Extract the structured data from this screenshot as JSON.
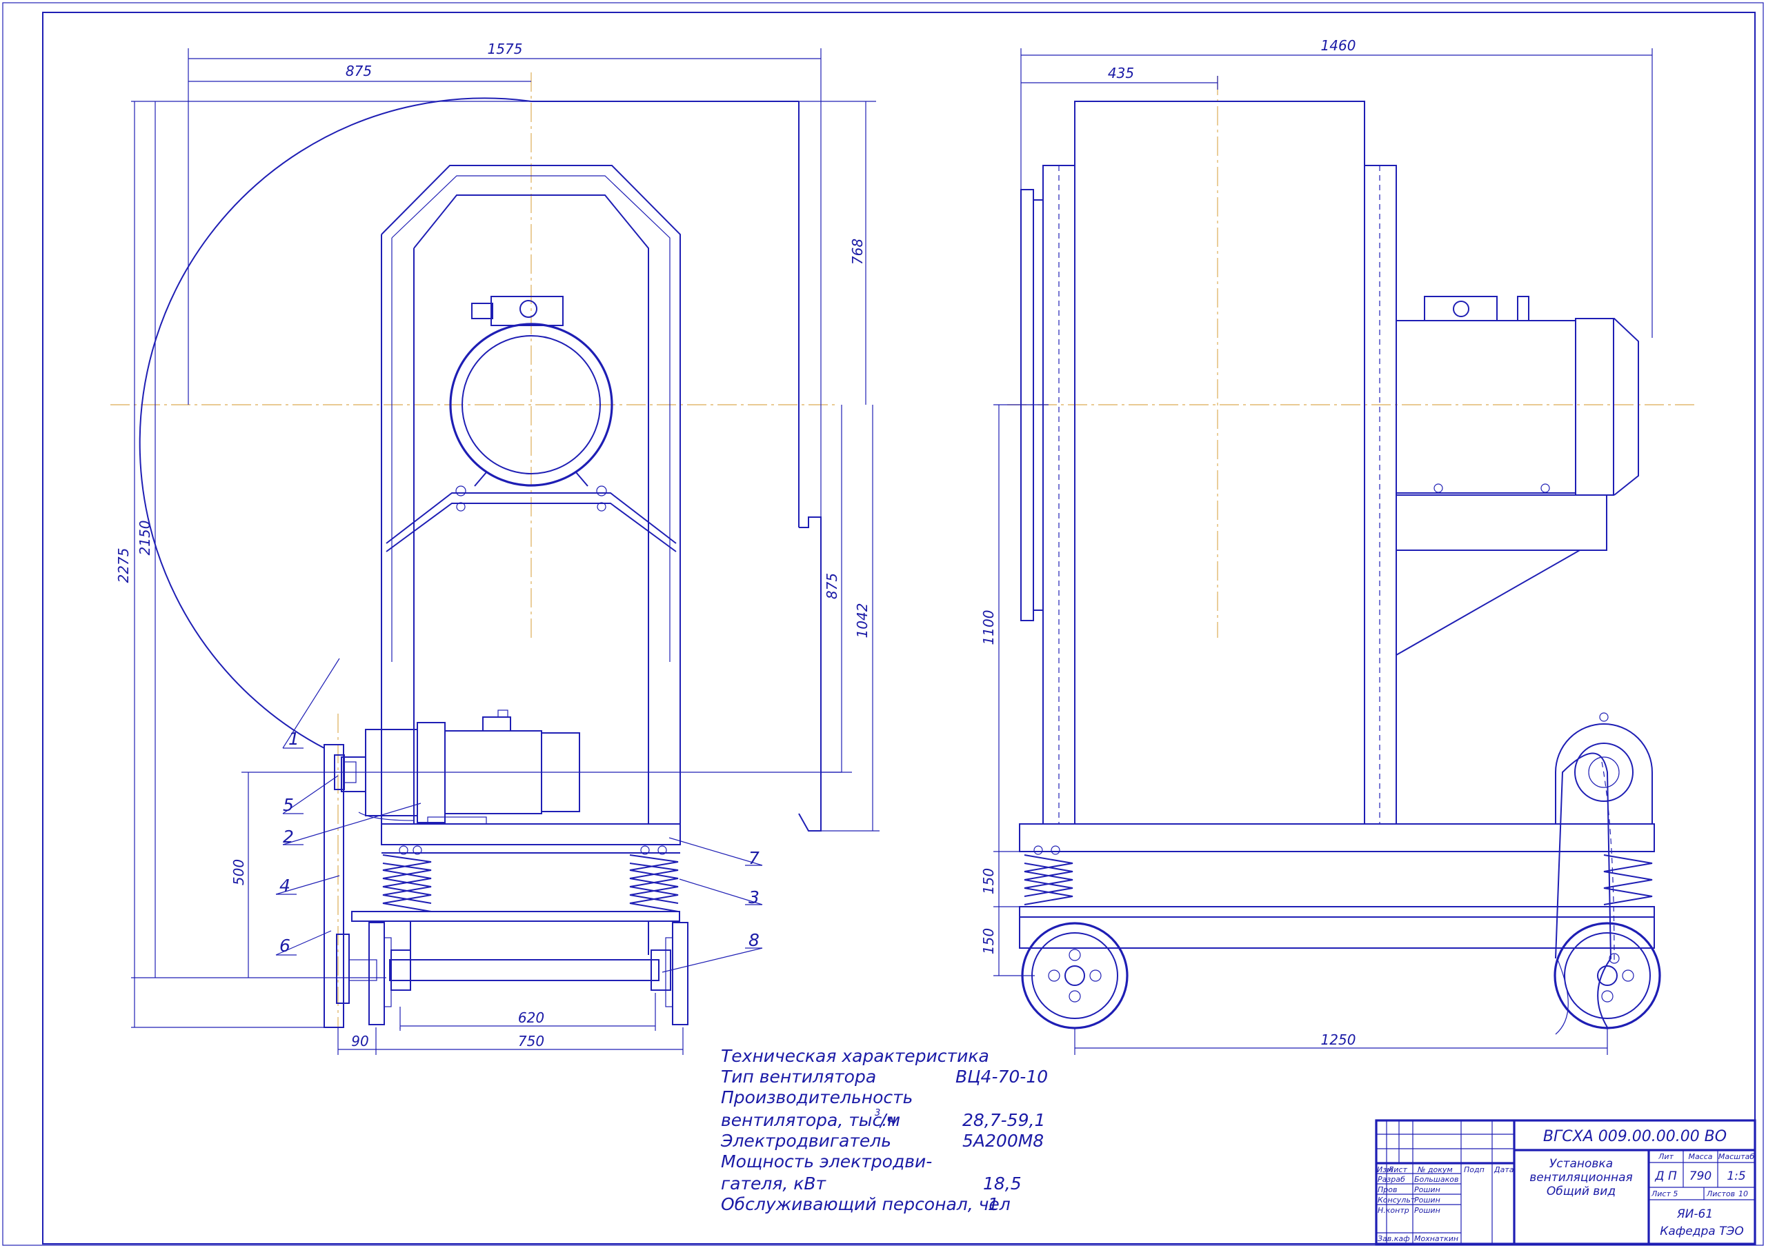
{
  "dimensions": {
    "total_width": "1575",
    "axis_offset": "875",
    "height_total": "2275",
    "height_2150": "2150",
    "top_768": "768",
    "outlet_875": "875",
    "outlet_1042": "1042",
    "drive_500": "500",
    "base_90": "90",
    "base_750": "750",
    "shaft_620": "620",
    "side_width": "1460",
    "side_435": "435",
    "side_1100": "1100",
    "side_150a": "150",
    "side_150b": "150",
    "wheelbase_1250": "1250"
  },
  "callouts": [
    "1",
    "2",
    "3",
    "4",
    "5",
    "6",
    "7",
    "8"
  ],
  "specs": {
    "heading": "Техническая характеристика",
    "fan_type_label": "Тип вентилятора",
    "fan_type_value": "ВЦ4-70-10",
    "capacity_label_1": "Производительность",
    "capacity_label_2": "вентилятора, тыс.м",
    "capacity_sup": "3",
    "capacity_unit": "/ч",
    "capacity_value": "28,7-59,1",
    "motor_label": "Электродвигатель",
    "motor_value": "5А200М8",
    "power_label_1": "Мощность электродви-",
    "power_label_2": "гателя, кВт",
    "power_value": "18,5",
    "staff_label": "Обслуживающий персонал, чел",
    "staff_value": "1"
  },
  "title_block": {
    "doc_code": "ВГСХА 009.00.00.00 ВО",
    "title_1": "Установка",
    "title_2": "вентиляционная",
    "title_3": "Общий вид",
    "col_headers": [
      "Изм",
      "Лист",
      "№ докум",
      "Подп",
      "Дата"
    ],
    "roles": [
      "Разраб",
      "Пров",
      "Консульт",
      "Н.контр",
      "Зав.каф"
    ],
    "names": [
      "Большаков",
      "Рошин",
      "Рошин",
      "Рошин",
      "Мохнаткин"
    ],
    "lit_label": "Лит",
    "mass_label": "Масса",
    "scale_label": "Масштаб",
    "lit_value": "Д П",
    "mass_value": "790",
    "scale_value": "1:5",
    "sheet_label": "Лист 5",
    "sheets_label": "Листов",
    "sheets_value": "10",
    "group": "ЯИ-61",
    "department": "Кафедра ТЭО"
  }
}
